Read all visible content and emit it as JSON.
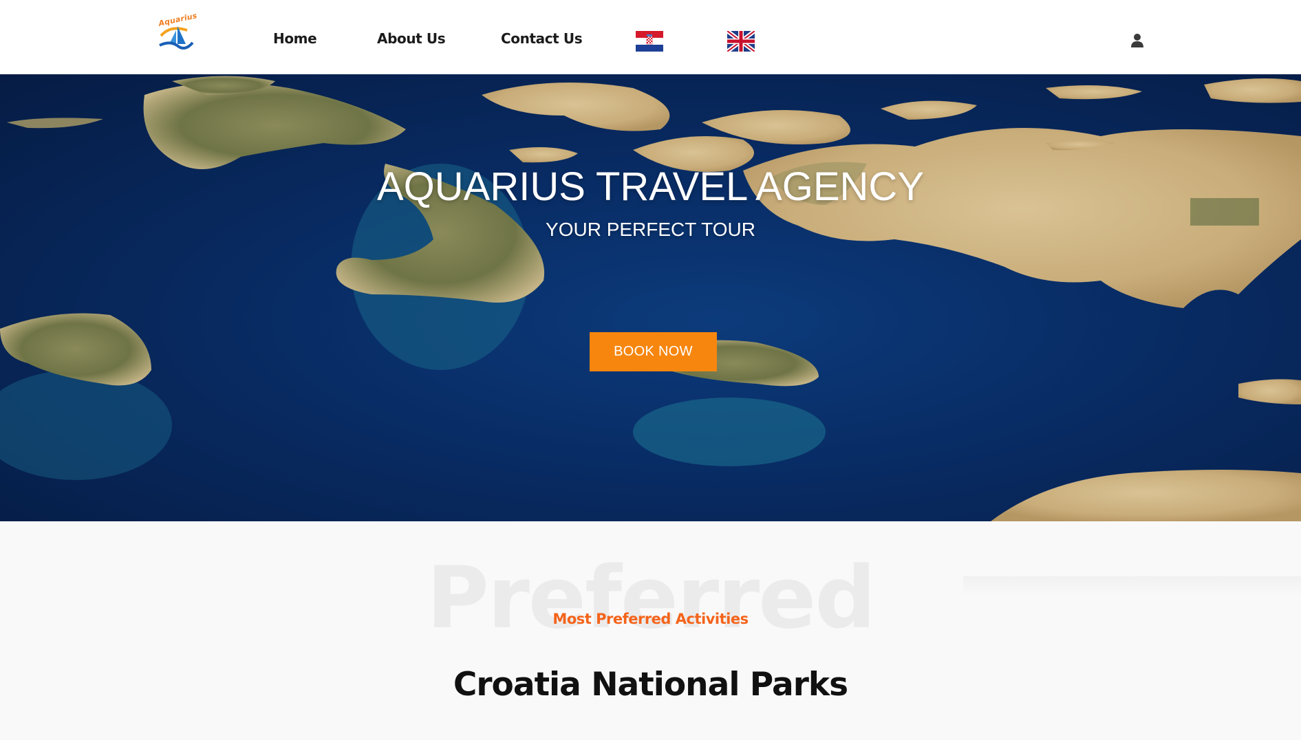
{
  "nav": {
    "logo_text": "Aquarius",
    "links": [
      {
        "label": "Home"
      },
      {
        "label": "About Us"
      },
      {
        "label": "Contact Us"
      }
    ],
    "languages": [
      "croatian-flag",
      "uk-flag"
    ],
    "user_icon": "user-icon"
  },
  "hero": {
    "title": "AQUARIUS TRAVEL AGENCY",
    "subtitle": "YOUR PERFECT TOUR",
    "cta_label": "BOOK NOW"
  },
  "section": {
    "watermark": "Preferred",
    "eyebrow": "Most Preferred Activities",
    "title": "Croatia National Parks"
  },
  "colors": {
    "accent_orange": "#f7860f",
    "eyebrow_orange": "#f4641b",
    "sea_blue": "#082b63"
  }
}
